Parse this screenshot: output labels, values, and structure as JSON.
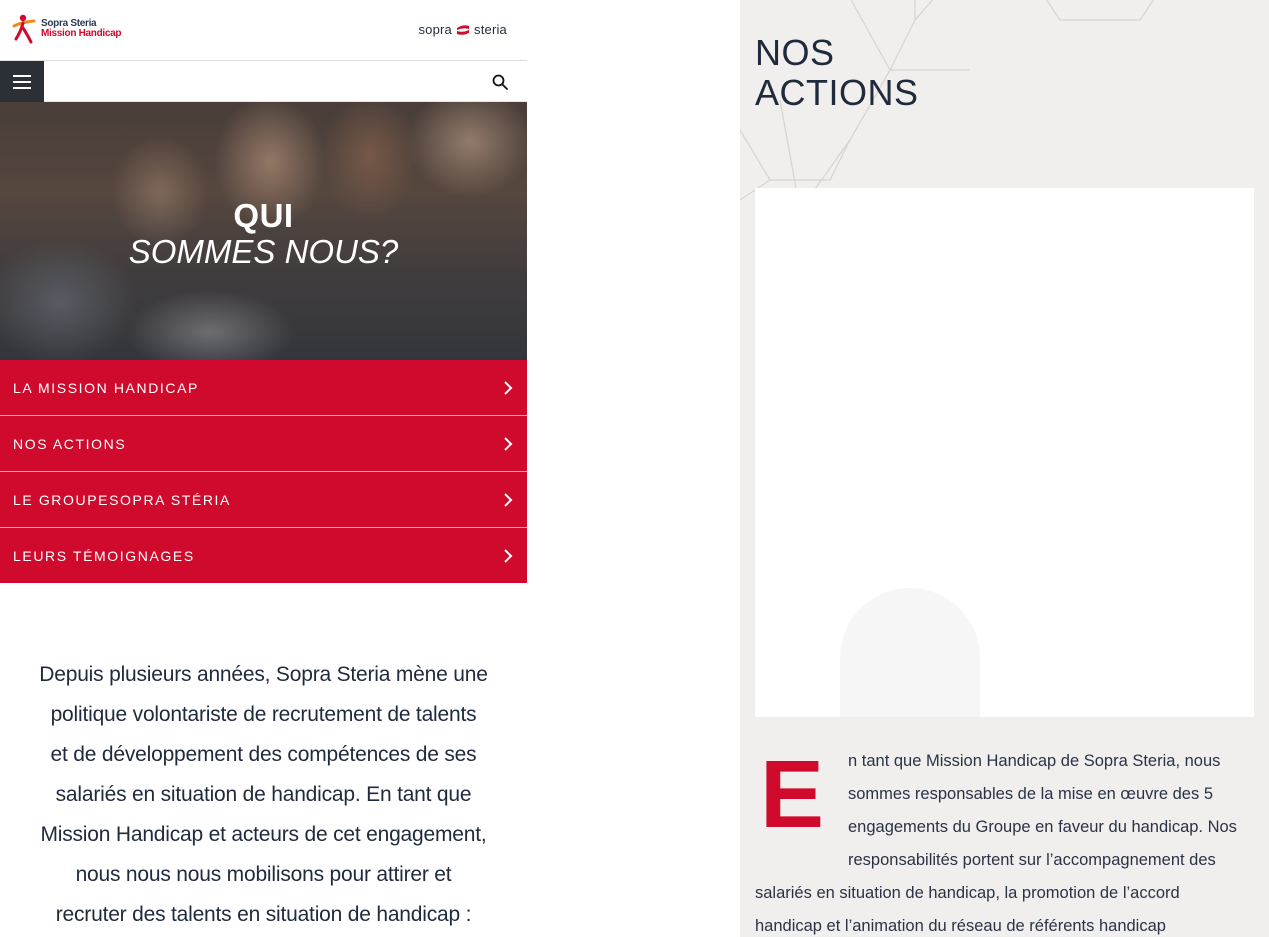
{
  "left_page": {
    "header": {
      "logo_line1": "Sopra Steria",
      "logo_line2": "Mission Handicap",
      "brand_left": "sopra",
      "brand_right": "steria"
    },
    "hero": {
      "title_line1": "QUI",
      "title_line2": "SOMMES NOUS?"
    },
    "menu": {
      "items": [
        {
          "label": "LA MISSION HANDICAP"
        },
        {
          "label": "NOS ACTIONS"
        },
        {
          "label": "LE GROUPESOPRA STÉRIA"
        },
        {
          "label": "LEURS TÉMOIGNAGES"
        }
      ]
    },
    "intro": {
      "lines": [
        "Depuis plusieurs années, Sopra Steria mène une",
        "politique volontariste de recrutement de talents",
        "et de développement des compétences de ses",
        "salariés en situation de handicap. En tant que",
        "Mission Handicap et acteurs de cet engagement,",
        "nous nous nous mobilisons pour attirer et",
        "recruter des talents en situation de handicap :"
      ]
    }
  },
  "right_page": {
    "title_line1": "NOS",
    "title_line2": "ACTIONS",
    "dropcap": "E",
    "body_lines": [
      "n tant que Mission Handicap de Sopra Steria, nous",
      "sommes responsables de la mise en œuvre des 5",
      "engagements du Groupe en faveur du handicap. Nos",
      "responsabilités portent sur l’accompagnement des",
      "salariés en situation de handicap, la promotion de l’accord",
      "handicap et l’animation du réseau de référents handicap"
    ]
  },
  "colors": {
    "accent_red": "#cf0a2c",
    "dark_navy": "#1f2a3c",
    "burger_bg": "#2b2f36",
    "right_bg": "#f0efed"
  },
  "icons": [
    "mission-handicap-logo-icon",
    "sopra-steria-mark-icon",
    "hamburger-menu-icon",
    "search-icon",
    "chevron-right-icon"
  ]
}
